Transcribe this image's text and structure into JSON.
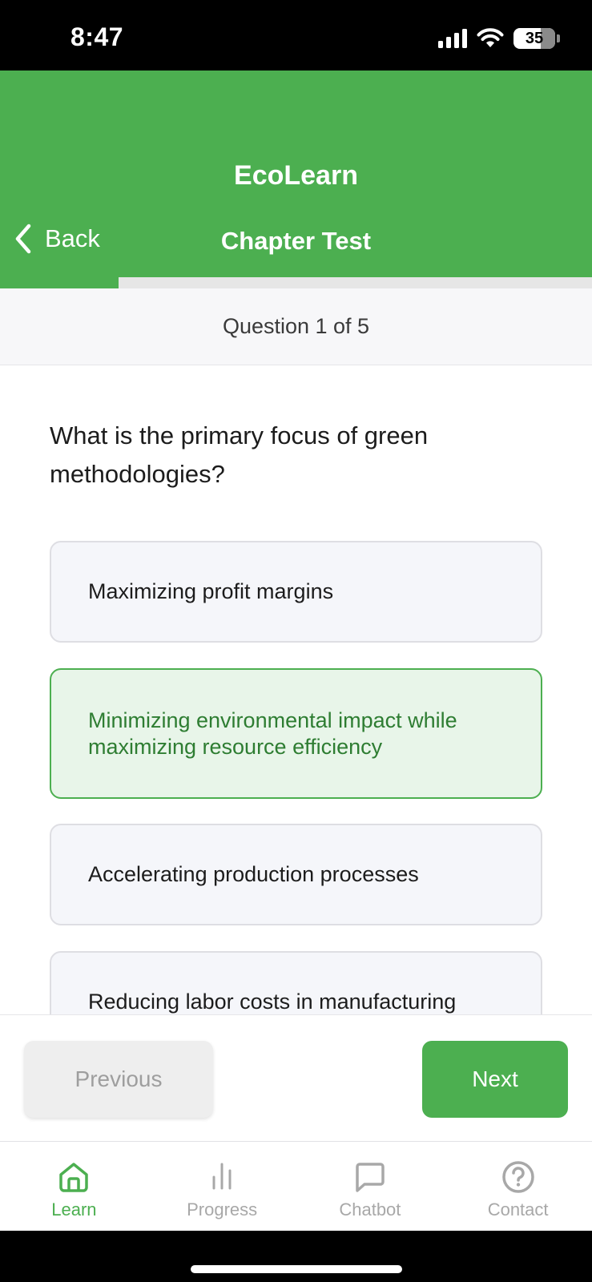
{
  "status_bar": {
    "time": "8:47",
    "battery": "35"
  },
  "header": {
    "app_name": "EcoLearn",
    "back_label": "Back",
    "screen_title": "Chapter Test"
  },
  "progress": {
    "fraction": 0.2
  },
  "quiz": {
    "counter": "Question 1 of 5",
    "question": "What is the primary focus of green methodologies?",
    "options": [
      "Maximizing profit margins",
      "Minimizing environmental impact while maximizing resource efficiency",
      "Accelerating production processes",
      "Reducing labor costs in manufacturing"
    ],
    "selected_index": 1
  },
  "navigation": {
    "previous_label": "Previous",
    "next_label": "Next"
  },
  "tabs": [
    {
      "label": "Learn",
      "icon": "home-icon",
      "active": true
    },
    {
      "label": "Progress",
      "icon": "bar-chart-icon",
      "active": false
    },
    {
      "label": "Chatbot",
      "icon": "chat-bubble-icon",
      "active": false
    },
    {
      "label": "Contact",
      "icon": "help-circle-icon",
      "active": false
    }
  ],
  "colors": {
    "accent": "#4caf50",
    "accent_dark": "#2e7d32",
    "selected_bg": "#e8f5e9",
    "inactive": "#a8a8a8"
  }
}
